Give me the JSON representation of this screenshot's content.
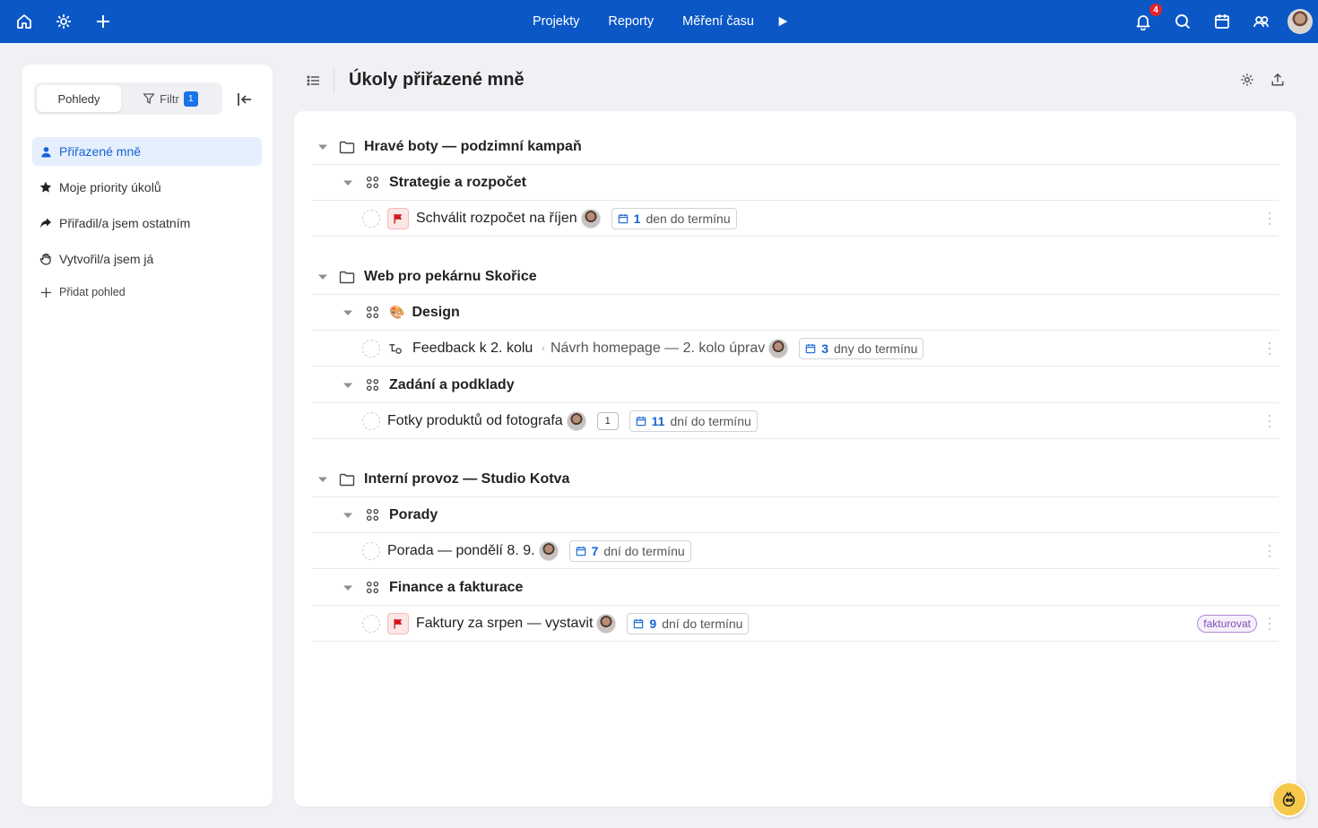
{
  "topbar": {
    "nav": [
      "Projekty",
      "Reporty",
      "Měření času"
    ],
    "notification_count": "4",
    "bg_color": "#0b57c6"
  },
  "sidebar": {
    "tabs": {
      "views": "Pohledy",
      "filter": "Filtr",
      "filter_count": "1"
    },
    "items": [
      {
        "label": "Přiřazené mně",
        "icon": "person-icon",
        "active": true
      },
      {
        "label": "Moje priority úkolů",
        "icon": "star-icon"
      },
      {
        "label": "Přiřadil/a jsem ostatním",
        "icon": "share-arrow-icon"
      },
      {
        "label": "Vytvořil/a jsem já",
        "icon": "hand-icon"
      }
    ],
    "add_view": "Přidat pohled"
  },
  "main": {
    "title": "Úkoly přiřazené mně",
    "projects": [
      {
        "name": "Hravé boty — podzimní kampaň",
        "sections": [
          {
            "name": "Strategie a rozpočet",
            "tasks": [
              {
                "title": "Schválit rozpočet na říjen",
                "due_num": "1",
                "due_text": "den do termínu",
                "flag": true
              }
            ]
          }
        ]
      },
      {
        "name": "Web pro pekárnu Skořice",
        "sections": [
          {
            "name": "Design",
            "emoji": "🎨",
            "tasks": [
              {
                "title": "Feedback k 2. kolu",
                "parent": "Návrh homepage — 2. kolo úprav",
                "due_num": "3",
                "due_text": "dny do termínu",
                "subtask": true
              }
            ]
          },
          {
            "name": "Zadání a podklady",
            "tasks": [
              {
                "title": "Fotky produktů od fotografa",
                "comments": "1",
                "due_num": "11",
                "due_text": "dní do termínu"
              }
            ]
          }
        ]
      },
      {
        "name": "Interní provoz — Studio Kotva",
        "sections": [
          {
            "name": "Porady",
            "tasks": [
              {
                "title": "Porada — pondělí 8. 9.",
                "due_num": "7",
                "due_text": "dní do termínu"
              }
            ]
          },
          {
            "name": "Finance a fakturace",
            "tasks": [
              {
                "title": "Faktury za srpen — vystavit",
                "due_num": "9",
                "due_text": "dní do termínu",
                "flag": true,
                "tag": "fakturovat"
              }
            ]
          }
        ]
      }
    ]
  }
}
